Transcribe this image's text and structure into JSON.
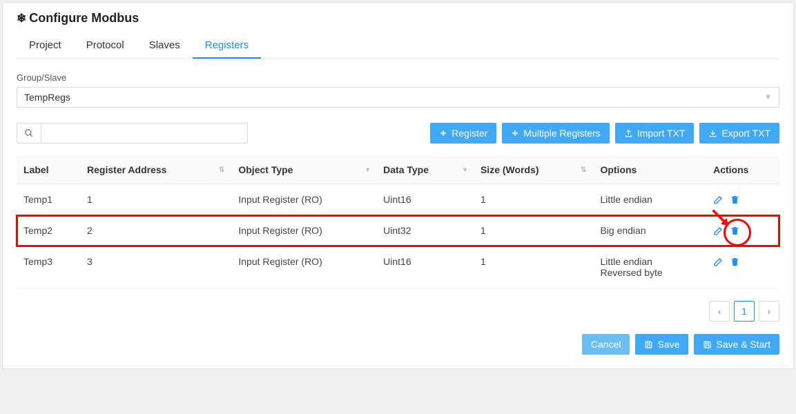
{
  "title": "Configure Modbus",
  "tabs": [
    {
      "label": "Project"
    },
    {
      "label": "Protocol"
    },
    {
      "label": "Slaves"
    },
    {
      "label": "Registers",
      "active": true
    }
  ],
  "groupslave": {
    "label": "Group/Slave",
    "selected": "TempRegs"
  },
  "search": {
    "placeholder": ""
  },
  "toolbar_buttons": {
    "register": "Register",
    "multiple": "Multiple Registers",
    "import": "Import TXT",
    "export": "Export TXT"
  },
  "columns": {
    "label": "Label",
    "address": "Register Address",
    "object_type": "Object Type",
    "data_type": "Data Type",
    "size": "Size (Words)",
    "options": "Options",
    "actions": "Actions"
  },
  "rows": [
    {
      "label": "Temp1",
      "address": "1",
      "object_type": "Input Register (RO)",
      "data_type": "Uint16",
      "size": "1",
      "options": "Little endian"
    },
    {
      "label": "Temp2",
      "address": "2",
      "object_type": "Input Register (RO)",
      "data_type": "Uint32",
      "size": "1",
      "options": "Big endian",
      "highlighted": true
    },
    {
      "label": "Temp3",
      "address": "3",
      "object_type": "Input Register (RO)",
      "data_type": "Uint16",
      "size": "1",
      "options": "Little endian\nReversed byte"
    }
  ],
  "pagination": {
    "page": "1"
  },
  "footer": {
    "cancel": "Cancel",
    "save": "Save",
    "save_start": "Save & Start"
  },
  "annotation": {
    "arrow": true,
    "circle_on_row": 1
  }
}
